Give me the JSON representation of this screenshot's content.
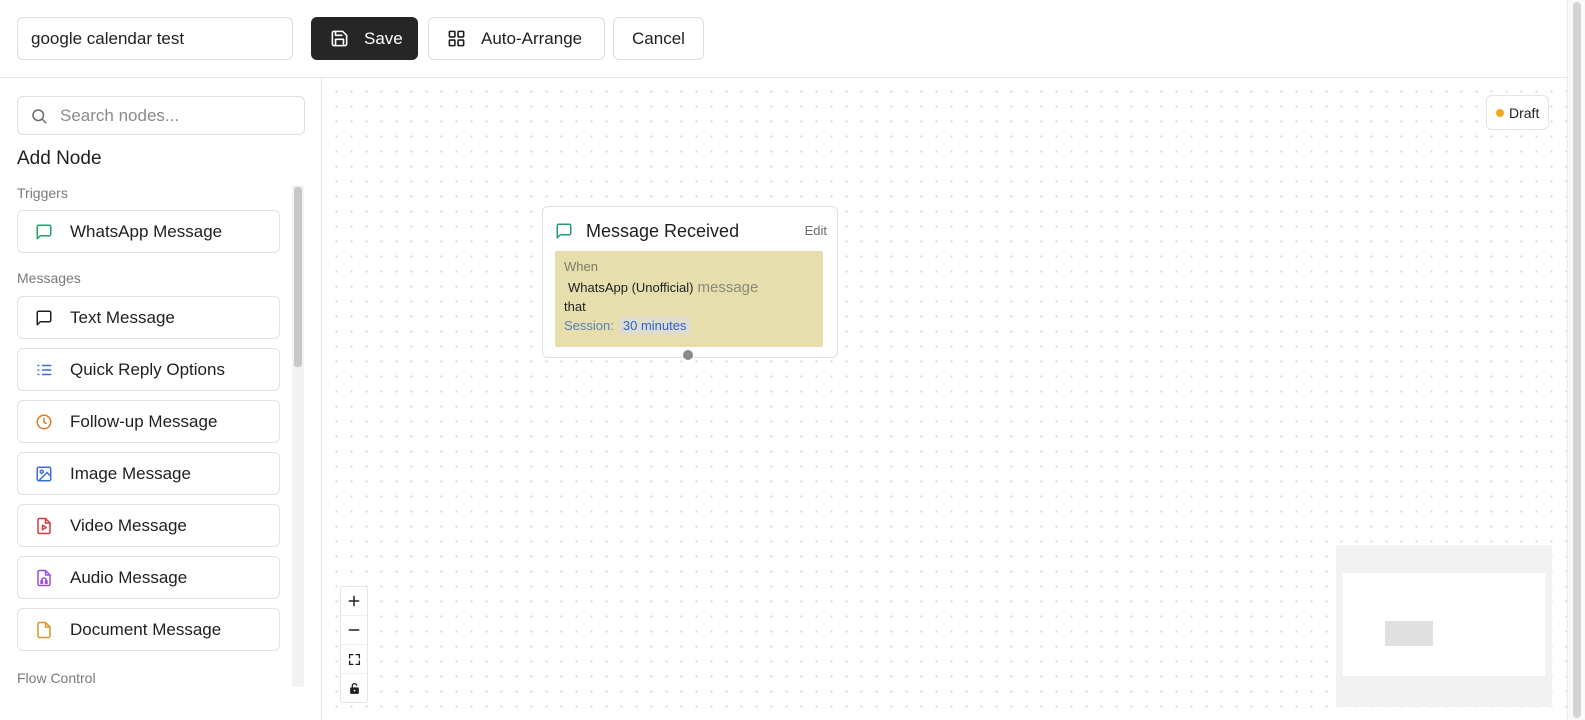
{
  "toolbar": {
    "flow_name": "google calendar test",
    "save_label": "Save",
    "auto_arrange_label": "Auto-Arrange",
    "cancel_label": "Cancel"
  },
  "sidebar": {
    "search_placeholder": "Search nodes...",
    "title": "Add Node",
    "sections": {
      "triggers": "Triggers",
      "messages": "Messages",
      "flow_control": "Flow Control"
    },
    "trigger_items": [
      {
        "label": "WhatsApp Message",
        "icon": "message-square-icon",
        "color": "#22a06b"
      }
    ],
    "message_items": [
      {
        "label": "Text Message",
        "icon": "message-square-icon",
        "color": "#1f1f1f"
      },
      {
        "label": "Quick Reply Options",
        "icon": "list-icon",
        "color": "#3b6fd4"
      },
      {
        "label": "Follow-up Message",
        "icon": "clock-icon",
        "color": "#e07b24"
      },
      {
        "label": "Image Message",
        "icon": "image-icon",
        "color": "#3b6fd4"
      },
      {
        "label": "Video Message",
        "icon": "file-video-icon",
        "color": "#d63a3a"
      },
      {
        "label": "Audio Message",
        "icon": "file-audio-icon",
        "color": "#9b4fd6"
      },
      {
        "label": "Document Message",
        "icon": "file-icon",
        "color": "#e0922a"
      }
    ]
  },
  "canvas": {
    "status": "Draft",
    "status_color": "#f0a81c",
    "node": {
      "title": "Message Received",
      "edit_label": "Edit",
      "when_label": "When",
      "platform": "WhatsApp (Unofficial)",
      "message_word": "message",
      "that_label": "that",
      "session_label": "Session:",
      "session_value": "30 minutes",
      "body_color": "#e6dfad"
    }
  }
}
